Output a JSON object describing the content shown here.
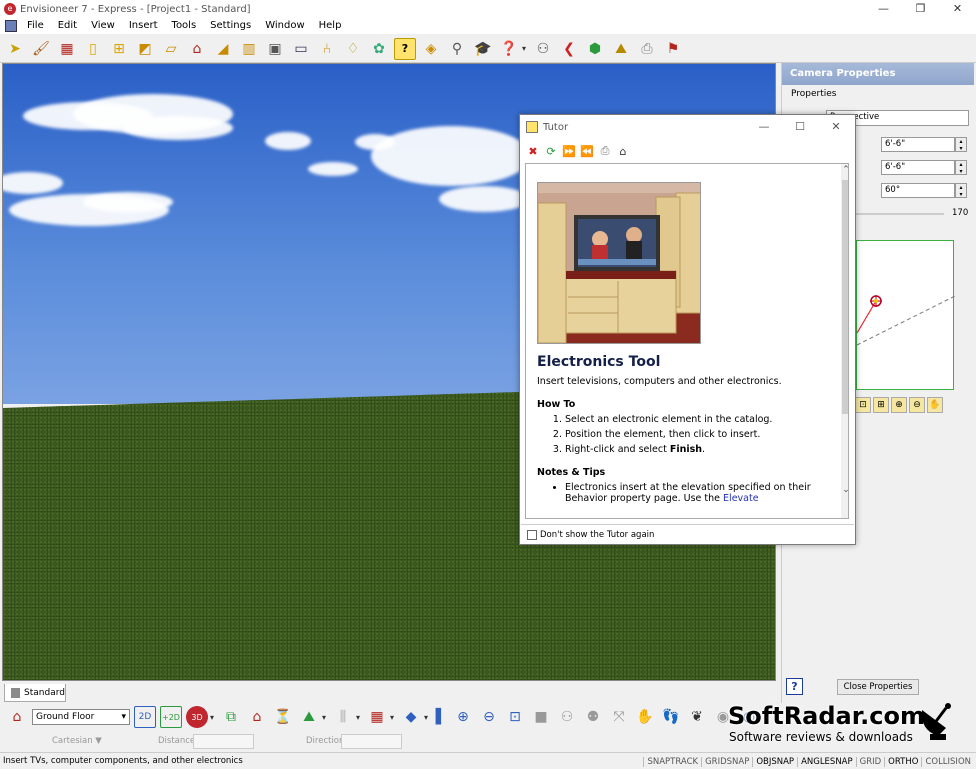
{
  "window": {
    "title": "Envisioneer 7 - Express - [Project1 - Standard]",
    "controls": [
      "—",
      "❐",
      "✕"
    ]
  },
  "menu": [
    "File",
    "Edit",
    "View",
    "Insert",
    "Tools",
    "Settings",
    "Window",
    "Help"
  ],
  "view_tab": {
    "label": "Standard"
  },
  "properties": {
    "title": "Camera Properties",
    "section": "Properties",
    "view_type": "Perspective",
    "height1": "6'-6\"",
    "height2": "6'-6\"",
    "angle": "60°",
    "slider_value": "170",
    "help_label": "?",
    "close_label": "Close Properties"
  },
  "tutor": {
    "title": "Tutor",
    "heading": "Electronics Tool",
    "intro": "Insert televisions, computers and other electronics.",
    "howto_title": "How To",
    "steps": [
      "Select an electronic element in the catalog.",
      "Position the element, then click to insert."
    ],
    "step3_prefix": "Right-click and select ",
    "step3_bold": "Finish",
    "step3_suffix": ".",
    "notes_title": "Notes & Tips",
    "note1": "Electronics insert at the elevation specified on their Behavior property page. Use the ",
    "note1_link": "Elevate",
    "dont_show": "Don't show the Tutor again"
  },
  "bottom_toolbar": {
    "floor": "Ground Floor"
  },
  "coords": {
    "mode": "Cartesian ▼",
    "distance_label": "Distance",
    "direction_label": "Direction"
  },
  "status": {
    "message": "Insert TVs, computer components, and other electronics",
    "snaps": [
      {
        "label": "SNAPTRACK",
        "on": false
      },
      {
        "label": "GRIDSNAP",
        "on": false
      },
      {
        "label": "OBJSNAP",
        "on": true
      },
      {
        "label": "ANGLESNAP",
        "on": true
      },
      {
        "label": "GRID",
        "on": false
      },
      {
        "label": "ORTHO",
        "on": true
      },
      {
        "label": "COLLISION",
        "on": false
      }
    ]
  },
  "watermark": {
    "brand": "SoftRadar.com",
    "tagline": "Software reviews & downloads"
  },
  "colors": {
    "accent_blue": "#2232b8",
    "header_blue": "#8fa6cc",
    "cam_border": "#3cb043"
  }
}
